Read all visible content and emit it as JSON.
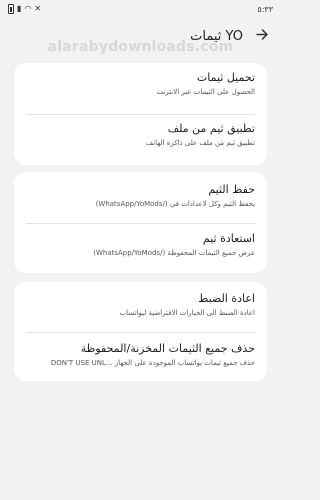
{
  "status_bar": {
    "time": "٥:٣٣"
  },
  "watermark": "alarabydownloads.com",
  "header": {
    "title": "ثيمات YO"
  },
  "sections": [
    {
      "items": [
        {
          "title": "تحميل ثيمات",
          "subtitle": "الحصول على الثيمات عبر الانترنت"
        },
        {
          "title": "تطبيق ثيم من ملف",
          "subtitle": "تطبيق ثيم من ملف على ذاكرة الهاتف"
        }
      ]
    },
    {
      "items": [
        {
          "title": "حفظ الثيم",
          "subtitle": "يحفظ الثيم وكل لاعدادات في (/WhatsApp/YoMods)"
        },
        {
          "title": "استعادة ثيم",
          "subtitle": "عرض جميع الثيمات المحفوظة (/WhatsApp/YoMods)"
        }
      ]
    },
    {
      "items": [
        {
          "title": "اعادة الضبط",
          "subtitle": "اعادة الضبط الى الخيارات الافتراضية ليواتساب"
        },
        {
          "title": "حذف جميع الثيمات المخزنة/المحفوظة",
          "subtitle": "حذف جميع ثيمات يواتساب الموجودة على الجهاز ...DON'T USE UNL"
        }
      ]
    }
  ]
}
